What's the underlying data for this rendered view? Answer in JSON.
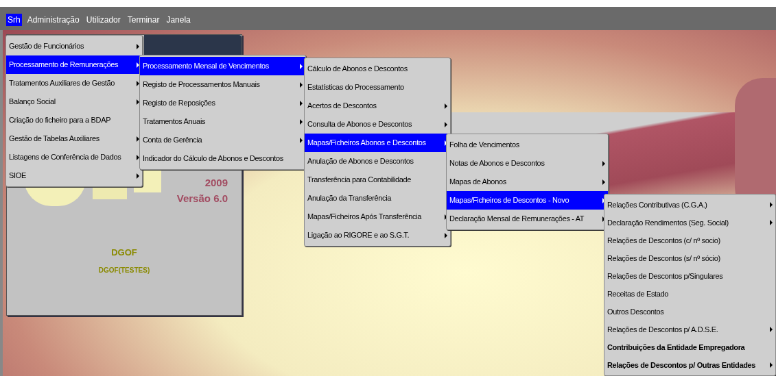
{
  "menubar": [
    {
      "label": "Srh",
      "selected": true
    },
    {
      "label": "Administração",
      "selected": false
    },
    {
      "label": "Utilizador",
      "selected": false
    },
    {
      "label": "Terminar",
      "selected": false
    },
    {
      "label": "Janela",
      "selected": false
    }
  ],
  "menus": [
    {
      "items": [
        {
          "label": "Gestão de Funcionários",
          "selected": false,
          "submenu": true
        },
        {
          "label": "Processamento de Remunerações",
          "selected": true,
          "submenu": true
        },
        {
          "label": "Tratamentos Auxiliares de Gestão",
          "selected": false,
          "submenu": true
        },
        {
          "label": "Balanço Social",
          "selected": false,
          "submenu": true
        },
        {
          "label": "Criação do ficheiro para a BDAP",
          "selected": false,
          "submenu": false
        },
        {
          "label": "Gestão de Tabelas Auxiliares",
          "selected": false,
          "submenu": true
        },
        {
          "label": "Listagens de Conferência de Dados",
          "selected": false,
          "submenu": true
        },
        {
          "label": "SIOE",
          "selected": false,
          "submenu": true
        }
      ]
    },
    {
      "items": [
        {
          "label": "Processamento Mensal de Vencimentos",
          "selected": true,
          "submenu": true
        },
        {
          "label": "Registo de Processamentos Manuais",
          "selected": false,
          "submenu": true
        },
        {
          "label": "Registo de Reposições",
          "selected": false,
          "submenu": true
        },
        {
          "label": "Tratamentos Anuais",
          "selected": false,
          "submenu": true
        },
        {
          "label": "Conta de Gerência",
          "selected": false,
          "submenu": true
        },
        {
          "label": "Indicador do Cálculo de Abonos e Descontos",
          "selected": false,
          "submenu": false
        }
      ]
    },
    {
      "items": [
        {
          "label": "Cálculo de Abonos e Descontos",
          "selected": false,
          "submenu": false
        },
        {
          "label": "Estatísticas do Processamento",
          "selected": false,
          "submenu": false
        },
        {
          "label": "Acertos de Descontos",
          "selected": false,
          "submenu": true
        },
        {
          "label": "Consulta de Abonos e Descontos",
          "selected": false,
          "submenu": true
        },
        {
          "label": "Mapas/Ficheiros Abonos e Descontos",
          "selected": true,
          "submenu": true
        },
        {
          "label": "Anulação de Abonos e Descontos",
          "selected": false,
          "submenu": false
        },
        {
          "label": "Transferência para Contabilidade",
          "selected": false,
          "submenu": false
        },
        {
          "label": "Anulação da Transferência",
          "selected": false,
          "submenu": false
        },
        {
          "label": "Mapas/Ficheiros Após Transferência",
          "selected": false,
          "submenu": true
        },
        {
          "label": "Ligação ao RIGORE e ao S.G.T.",
          "selected": false,
          "submenu": true
        }
      ]
    },
    {
      "items": [
        {
          "label": "Folha de Vencimentos",
          "selected": false,
          "submenu": false
        },
        {
          "label": "Notas de Abonos e Descontos",
          "selected": false,
          "submenu": true
        },
        {
          "label": "Mapas de Abonos",
          "selected": false,
          "submenu": true
        },
        {
          "label": "Mapas/Ficheiros de Descontos - Novo",
          "selected": true,
          "submenu": true
        },
        {
          "label": "Declaração Mensal de Remunerações - AT",
          "selected": false,
          "submenu": true
        }
      ]
    },
    {
      "items": [
        {
          "label": "Relações Contributivas (C.G.A.)",
          "selected": false,
          "submenu": true,
          "bold": false
        },
        {
          "label": "Declaração Rendimentos (Seg. Social)",
          "selected": false,
          "submenu": true,
          "bold": false
        },
        {
          "label": "Relações de Descontos (c/ nº socio)",
          "selected": false,
          "submenu": false,
          "bold": false
        },
        {
          "label": "Relações de Descontos (s/ nº sócio)",
          "selected": false,
          "submenu": false,
          "bold": false
        },
        {
          "label": "Relações de Descontos p/Singulares",
          "selected": false,
          "submenu": false,
          "bold": false
        },
        {
          "label": "Receitas de Estado",
          "selected": false,
          "submenu": false,
          "bold": false
        },
        {
          "label": "Outros Descontos",
          "selected": false,
          "submenu": false,
          "bold": false
        },
        {
          "label": "Relações de Descontos p/ A.D.S.E.",
          "selected": false,
          "submenu": true,
          "bold": false
        },
        {
          "label": "Contribuições da Entidade Empregadora",
          "selected": false,
          "submenu": false,
          "bold": true
        },
        {
          "label": "Relações de Descontos p/ Outras Entidades",
          "selected": false,
          "submenu": true,
          "bold": true
        }
      ]
    }
  ],
  "splash": {
    "year": "2009",
    "version": "Versão 6.0",
    "organization": "DGOF",
    "instance": "DGOF(TESTES)"
  }
}
